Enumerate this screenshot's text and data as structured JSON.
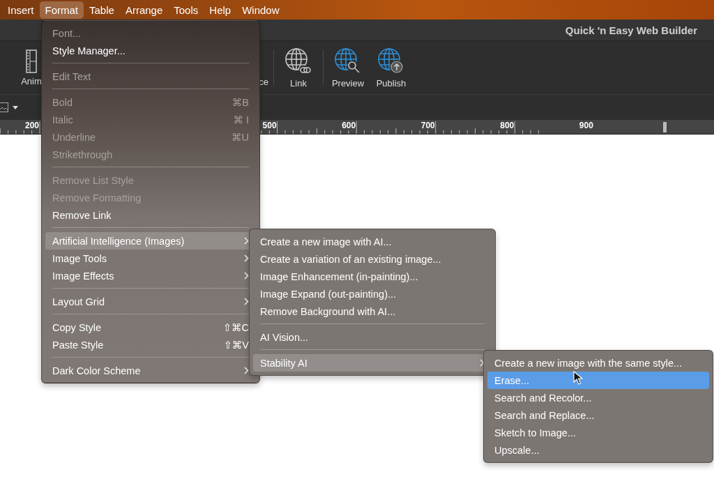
{
  "menubar": [
    {
      "label": "Insert",
      "selected": false
    },
    {
      "label": "Format",
      "selected": true
    },
    {
      "label": "Table",
      "selected": false
    },
    {
      "label": "Arrange",
      "selected": false
    },
    {
      "label": "Tools",
      "selected": false
    },
    {
      "label": "Help",
      "selected": false
    },
    {
      "label": "Window",
      "selected": false
    }
  ],
  "window": {
    "title": "Quick 'n Easy Web Builder"
  },
  "toolbar": [
    {
      "kind": "film",
      "label": "Anim"
    },
    {
      "kind": "blank",
      "label": "ce"
    },
    {
      "kind": "link",
      "label": "Link"
    },
    {
      "kind": "preview",
      "label": "Preview"
    },
    {
      "kind": "publish",
      "label": "Publish"
    }
  ],
  "ruler": {
    "labels": [
      "200",
      "500",
      "600",
      "700",
      "800",
      "900"
    ]
  },
  "menus": [
    {
      "focused": false,
      "items": [
        {
          "kind": "item",
          "label": "Font...",
          "disabled": true,
          "selected": false
        },
        {
          "kind": "item",
          "label": "Style Manager...",
          "disabled": false,
          "selected": false
        },
        {
          "kind": "separator"
        },
        {
          "kind": "item",
          "label": "Edit Text",
          "disabled": true,
          "selected": false
        },
        {
          "kind": "separator"
        },
        {
          "kind": "item",
          "label": "Bold",
          "disabled": true,
          "selected": false,
          "shortcut": "⌘B"
        },
        {
          "kind": "item",
          "label": "Italic",
          "disabled": true,
          "selected": false,
          "shortcut": "⌘ I"
        },
        {
          "kind": "item",
          "label": "Underline",
          "disabled": true,
          "selected": false,
          "shortcut": "⌘U"
        },
        {
          "kind": "item",
          "label": "Strikethrough",
          "disabled": true,
          "selected": false
        },
        {
          "kind": "separator"
        },
        {
          "kind": "item",
          "label": "Remove List Style",
          "disabled": true,
          "selected": false
        },
        {
          "kind": "item",
          "label": "Remove Formatting",
          "disabled": true,
          "selected": false
        },
        {
          "kind": "item",
          "label": "Remove Link",
          "disabled": false,
          "selected": false
        },
        {
          "kind": "separator"
        },
        {
          "kind": "item",
          "label": "Artificial Intelligence (Images)",
          "disabled": false,
          "selected": true,
          "submenu": true
        },
        {
          "kind": "item",
          "label": "Image Tools",
          "disabled": false,
          "selected": false,
          "submenu": true
        },
        {
          "kind": "item",
          "label": "Image Effects",
          "disabled": false,
          "selected": false,
          "submenu": true
        },
        {
          "kind": "separator"
        },
        {
          "kind": "item",
          "label": "Layout Grid",
          "disabled": false,
          "selected": false,
          "submenu": true
        },
        {
          "kind": "separator"
        },
        {
          "kind": "item",
          "label": "Copy Style",
          "disabled": false,
          "selected": false,
          "shortcut": "⇧⌘C"
        },
        {
          "kind": "item",
          "label": "Paste Style",
          "disabled": false,
          "selected": false,
          "shortcut": "⇧⌘V"
        },
        {
          "kind": "separator"
        },
        {
          "kind": "item",
          "label": "Dark Color Scheme",
          "disabled": false,
          "selected": false,
          "submenu": true
        }
      ]
    },
    {
      "focused": false,
      "items": [
        {
          "kind": "item",
          "label": "Create a new image with AI...",
          "disabled": false,
          "selected": false
        },
        {
          "kind": "item",
          "label": "Create a variation of an existing image...",
          "disabled": false,
          "selected": false
        },
        {
          "kind": "item",
          "label": "Image Enhancement (in-painting)...",
          "disabled": false,
          "selected": false
        },
        {
          "kind": "item",
          "label": "Image Expand (out-painting)...",
          "disabled": false,
          "selected": false
        },
        {
          "kind": "item",
          "label": "Remove Background with AI...",
          "disabled": false,
          "selected": false
        },
        {
          "kind": "separator"
        },
        {
          "kind": "item",
          "label": "AI Vision...",
          "disabled": false,
          "selected": false
        },
        {
          "kind": "separator"
        },
        {
          "kind": "item",
          "label": "Stability AI",
          "disabled": false,
          "selected": true,
          "submenu": true
        }
      ]
    },
    {
      "focused": true,
      "items": [
        {
          "kind": "item",
          "label": "Create a new image with the same style...",
          "disabled": false,
          "selected": false
        },
        {
          "kind": "item",
          "label": "Erase...",
          "disabled": false,
          "selected": true
        },
        {
          "kind": "item",
          "label": "Search and Recolor...",
          "disabled": false,
          "selected": false
        },
        {
          "kind": "item",
          "label": "Search and Replace...",
          "disabled": false,
          "selected": false
        },
        {
          "kind": "item",
          "label": "Sketch to Image...",
          "disabled": false,
          "selected": false
        },
        {
          "kind": "item",
          "label": "Upscale...",
          "disabled": false,
          "selected": false
        }
      ]
    }
  ]
}
